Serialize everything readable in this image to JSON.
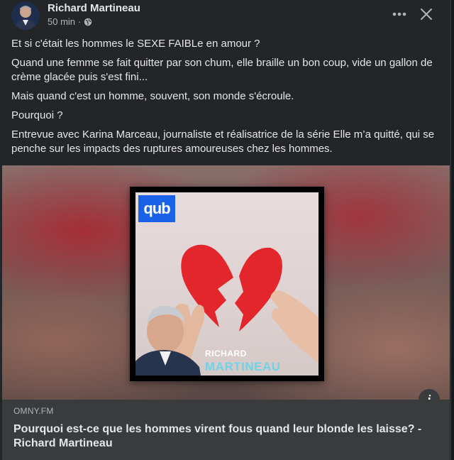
{
  "post": {
    "author": "Richard Martineau",
    "time": "50 min",
    "separator": "·",
    "paragraphs": [
      "Et si c'était les hommes le SEXE FAIBLe en amour ?",
      "Quand une femme se fait quitter par son chum, elle braille un bon coup, vide un gallon de crème glacée puis s'est fini...",
      "Mais quand c'est un homme, souvent, son monde s'écroule.",
      "Pourquoi ?",
      "Entrevue avec Karina Marceau, journaliste et réalisatrice de la série Elle m’a quitté, qui se penche sur les impacts des ruptures amoureuses chez les hommes."
    ],
    "icons": {
      "audience": "globe-icon",
      "more": "more-options-icon",
      "close": "close-icon",
      "info": "info-icon"
    }
  },
  "media": {
    "brand": "qub",
    "cover_line1": "RICHARD",
    "cover_line2": "MARTINEAU",
    "info_glyph": "i"
  },
  "link": {
    "domain": "OMNY.FM",
    "title": "Pourquoi est-ce que les hommes virent fous quand leur blonde les laisse? - Richard Martineau"
  },
  "colors": {
    "background": "#242526",
    "text": "#e4e6eb",
    "secondary_text": "#b0b3b8",
    "link_card": "#3a3b3c",
    "brand_blue": "#1a62e8",
    "heart_red": "#e2262b",
    "name_cyan": "#6fd3e8"
  }
}
